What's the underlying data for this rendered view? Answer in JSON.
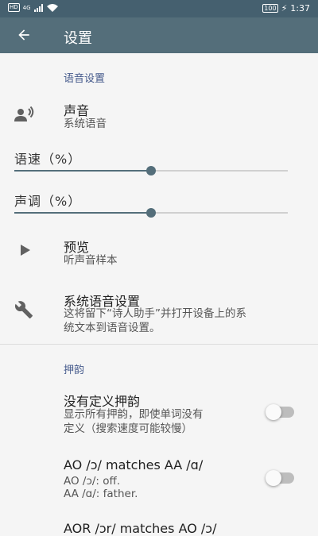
{
  "status_bar": {
    "hd": "HD",
    "network": "4G",
    "battery": "100",
    "time": "1:37"
  },
  "toolbar": {
    "title": "设置",
    "back_icon": "arrow-back-icon"
  },
  "sections": {
    "voice": {
      "header": "语音设置"
    },
    "rhymes": {
      "header": "押韵"
    }
  },
  "voice": {
    "icon": "record-voice-icon",
    "title": "声音",
    "summary": "系统语音"
  },
  "speech_rate": {
    "label": "语速（%）",
    "value": 50
  },
  "pitch": {
    "label": "声调（%）",
    "value": 50
  },
  "preview": {
    "icon": "play-icon",
    "title": "预览",
    "summary": "听声音样本"
  },
  "system_tts": {
    "icon": "wrench-icon",
    "title": "系统语音设置",
    "summary_line1": "这将留下“诗人助手”并打开设备上的系",
    "summary_line2": "统文本到语音设置。"
  },
  "undefined_rhymes": {
    "title": "没有定义押韵",
    "summary_line1": "显示所有押韵，即使单词没有",
    "summary_line2": "定义（搜索速度可能较慢）",
    "enabled": false
  },
  "ao_match": {
    "title": "AO /ɔ/ matches AA /ɑ/",
    "summary_line1": "AO /ɔ/: off.",
    "summary_line2": "AA /ɑ/: father.",
    "enabled": false
  },
  "aor_match": {
    "title": "AOR /ɔr/ matches AO /ɔ/"
  },
  "colors": {
    "status_bar": "#45606f",
    "toolbar": "#546e7a",
    "accent": "#546e7a",
    "section_header": "#455a8c"
  }
}
